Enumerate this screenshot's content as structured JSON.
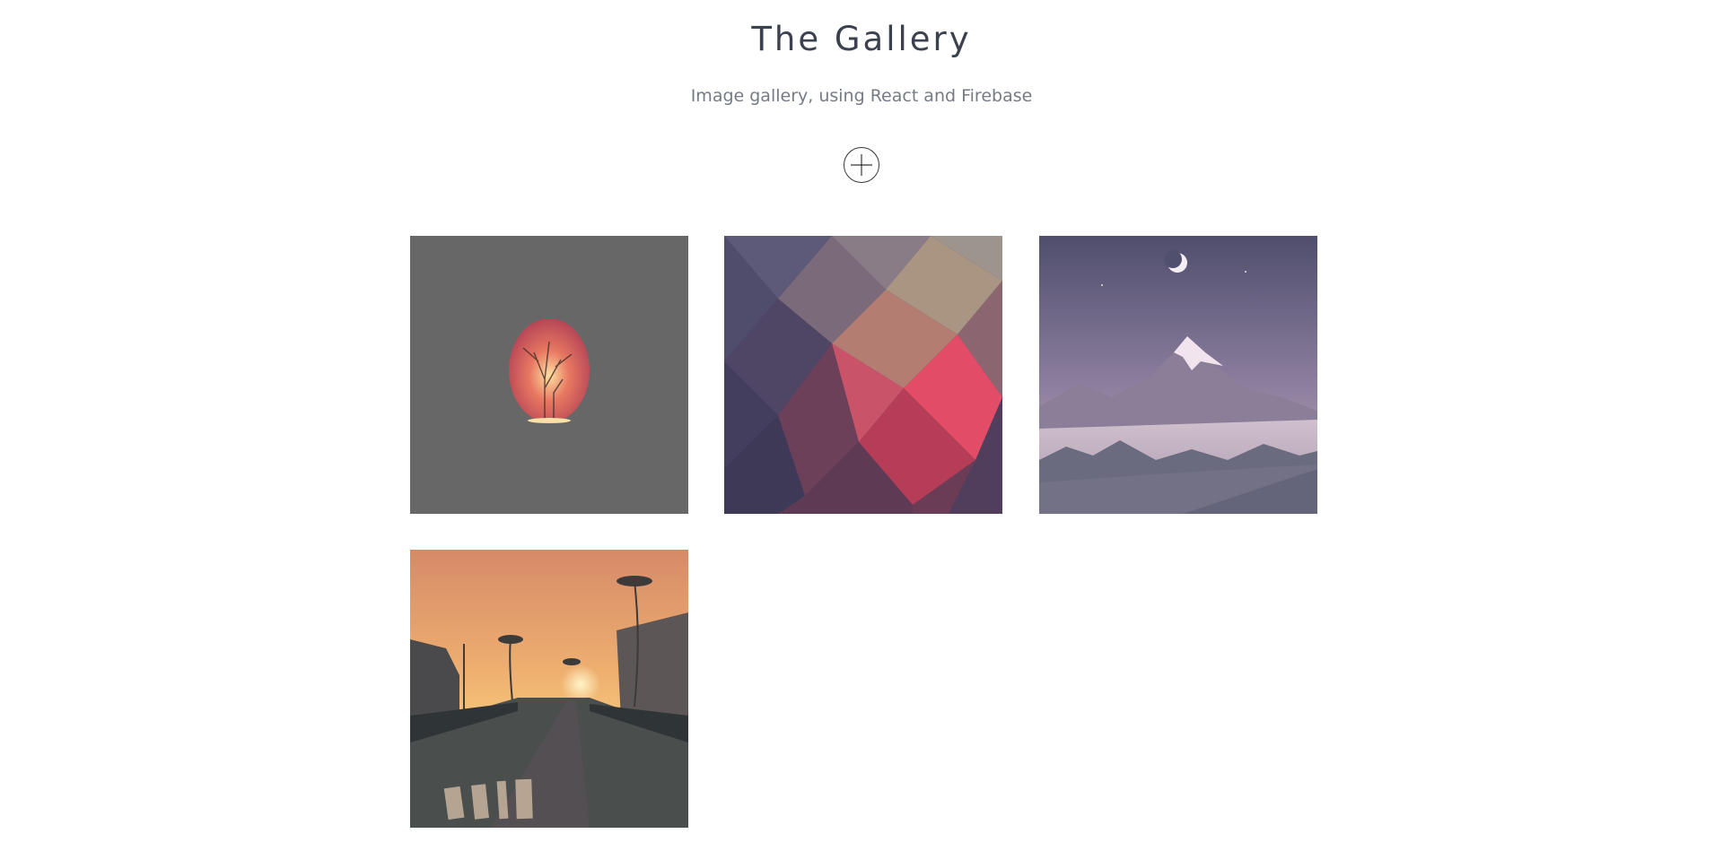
{
  "header": {
    "title": "The Gallery",
    "subtitle": "Image gallery, using React and Firebase"
  },
  "upload": {
    "icon": "plus-circle-icon"
  },
  "gallery": {
    "images": [
      {
        "subject": "glowing tree silhouette on grey",
        "colors": [
          "#676767",
          "#d85d5a",
          "#f6c06e"
        ]
      },
      {
        "subject": "low-poly purple and red abstract",
        "colors": [
          "#4a4664",
          "#c8455b",
          "#a48a7c"
        ]
      },
      {
        "subject": "snowy mountain under crescent moon",
        "colors": [
          "#5b5a78",
          "#c9b5c5",
          "#6c6d80"
        ]
      },
      {
        "subject": "palm tree street at sunset",
        "colors": [
          "#e3a06a",
          "#3e4a4a",
          "#f5cf7a"
        ]
      }
    ]
  }
}
